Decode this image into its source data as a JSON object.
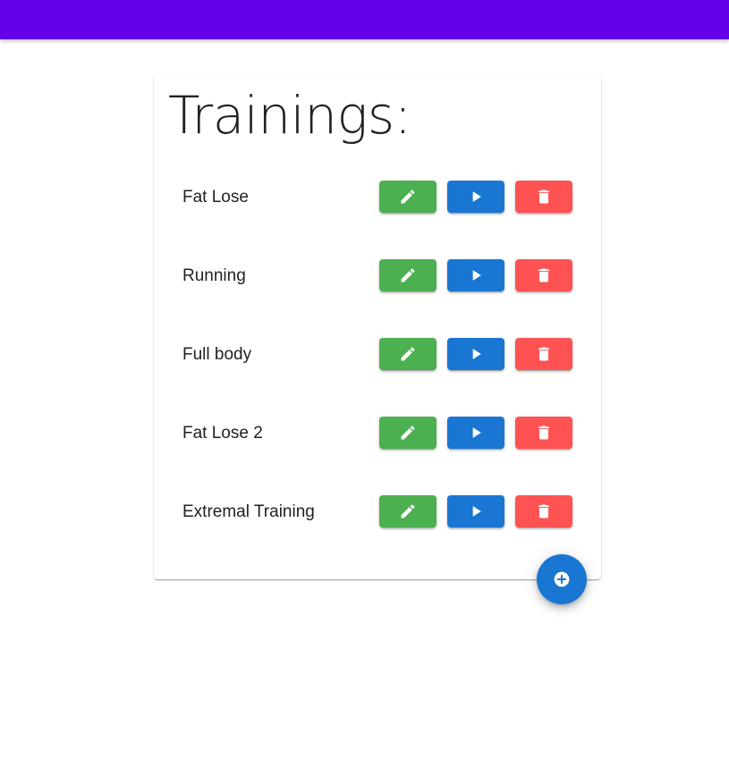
{
  "app_bar": {
    "color": "#6200ea"
  },
  "card": {
    "title": "Trainings:"
  },
  "trainings": [
    {
      "name": "Fat Lose"
    },
    {
      "name": "Running"
    },
    {
      "name": "Full body"
    },
    {
      "name": "Fat Lose 2"
    },
    {
      "name": "Extremal Training"
    }
  ],
  "actions": {
    "edit": {
      "icon": "pencil-icon",
      "color": "#4caf50"
    },
    "play": {
      "icon": "play-icon",
      "color": "#1976d2"
    },
    "delete": {
      "icon": "trash-icon",
      "color": "#ff5252"
    }
  },
  "fab": {
    "icon": "plus-circle-icon",
    "color": "#1976d2"
  }
}
